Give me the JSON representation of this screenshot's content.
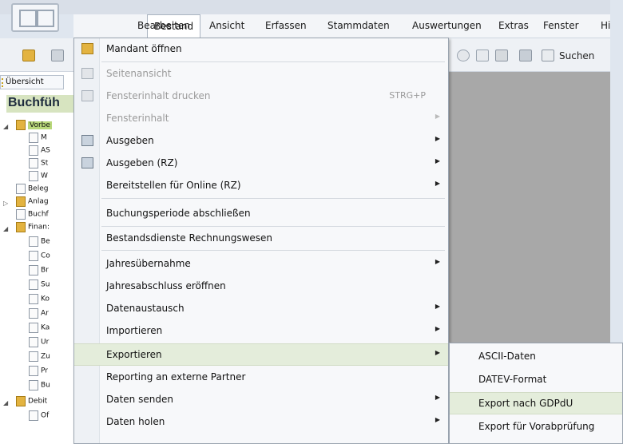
{
  "menubar": {
    "items": [
      "Bestand",
      "Bearbeiten",
      "Ansicht",
      "Erfassen",
      "Stammdaten",
      "Auswertungen",
      "Extras",
      "Fenster",
      "Hil"
    ]
  },
  "toolbar": {
    "search_label": "Suchen"
  },
  "left_panel": {
    "overview_tab": "Übersicht",
    "title": "Buchfüh",
    "tree": [
      "Vorbe",
      "M",
      "AS",
      "St",
      "W",
      "Beleg",
      "Anlag",
      "Buchf",
      "Finan:",
      "Be",
      "Co",
      "Br",
      "Su",
      "Ko",
      "Ar",
      "Ka",
      "Ur",
      "Zu",
      "Pr",
      "Bu",
      "Debit",
      "Of"
    ]
  },
  "dropdown": {
    "items": [
      {
        "label": "Mandant öffnen",
        "icon": "folder-open-icon"
      },
      {
        "label": "Seitenansicht",
        "icon": "print-preview-icon",
        "disabled": true
      },
      {
        "label": "Fensterinhalt drucken",
        "icon": "printer-icon",
        "shortcut": "STRG+P",
        "disabled": true
      },
      {
        "label": "Fensterinhalt",
        "disabled": true,
        "submenu": true
      },
      {
        "label": "Ausgeben",
        "icon": "output-icon",
        "submenu": true
      },
      {
        "label": "Ausgeben (RZ)",
        "icon": "output-rz-icon",
        "submenu": true
      },
      {
        "label": "Bereitstellen für Online (RZ)",
        "submenu": true
      },
      {
        "label": "Buchungsperiode abschließen"
      },
      {
        "label": "Bestandsdienste Rechnungswesen"
      },
      {
        "label": "Jahresübernahme",
        "submenu": true
      },
      {
        "label": "Jahresabschluss eröffnen"
      },
      {
        "label": "Datenaustausch",
        "submenu": true
      },
      {
        "label": "Importieren",
        "submenu": true
      },
      {
        "label": "Exportieren",
        "submenu": true,
        "highlighted": true
      },
      {
        "label": "Reporting an externe Partner"
      },
      {
        "label": "Daten senden",
        "submenu": true
      },
      {
        "label": "Daten holen",
        "submenu": true
      }
    ]
  },
  "submenu": {
    "items": [
      {
        "label": "ASCII-Daten"
      },
      {
        "label": "DATEV-Format"
      },
      {
        "label": "Export nach GDPdU",
        "highlighted": true
      },
      {
        "label": "Export für Vorabprüfung"
      }
    ]
  },
  "colors": {
    "highlight": "#e4eddb",
    "workspace": "#a8a8a8",
    "folder": "#e3b340"
  }
}
